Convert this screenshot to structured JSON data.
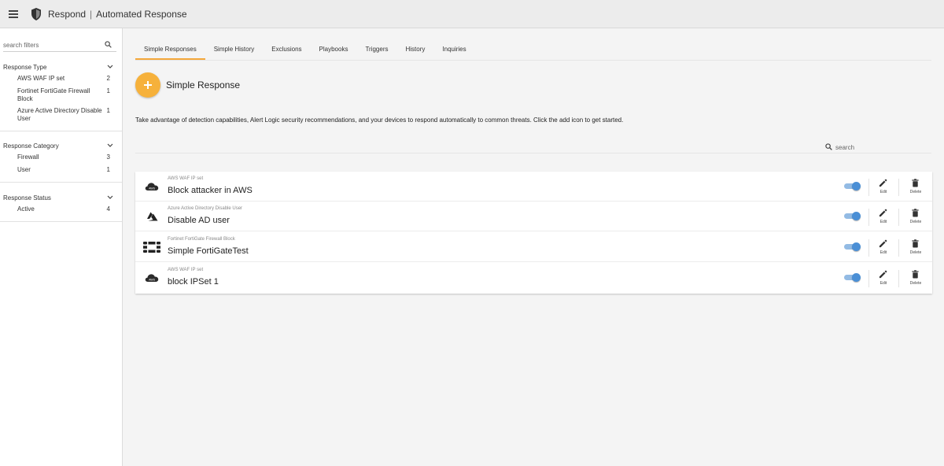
{
  "app": {
    "product": "Respond",
    "page": "Automated Response"
  },
  "sidebar": {
    "search_placeholder": "search filters",
    "facets": [
      {
        "title": "Response Type",
        "items": [
          {
            "label": "AWS WAF IP set",
            "count": "2"
          },
          {
            "label": "Fortinet FortiGate Firewall Block",
            "count": "1"
          },
          {
            "label": "Azure Active Directory Disable User",
            "count": "1"
          }
        ]
      },
      {
        "title": "Response Category",
        "items": [
          {
            "label": "Firewall",
            "count": "3"
          },
          {
            "label": "User",
            "count": "1"
          }
        ]
      },
      {
        "title": "Response Status",
        "items": [
          {
            "label": "Active",
            "count": "4"
          }
        ]
      }
    ]
  },
  "tabs": [
    "Simple Responses",
    "Simple History",
    "Exclusions",
    "Playbooks",
    "Triggers",
    "History",
    "Inquiries"
  ],
  "active_tab": "Simple Responses",
  "section_title": "Simple Response",
  "description": "Take advantage of detection capabilities, Alert Logic security recommendations, and your devices to respond automatically to common threats. Click the add icon to get started.",
  "search_placeholder": "search",
  "responses": [
    {
      "type": "AWS WAF IP set",
      "name": "Block attacker in AWS",
      "icon": "aws-cloud-icon",
      "enabled": true
    },
    {
      "type": "Azure Active Directory Disable User",
      "name": "Disable AD user",
      "icon": "azure-icon",
      "enabled": true
    },
    {
      "type": "Fortinet FortiGate Firewall Block",
      "name": "Simple FortiGateTest",
      "icon": "fortinet-icon",
      "enabled": true
    },
    {
      "type": "AWS WAF IP set",
      "name": "block IPSet 1",
      "icon": "aws-cloud-icon",
      "enabled": true
    }
  ],
  "actions": {
    "edit": "Edit",
    "delete": "Delete"
  },
  "colors": {
    "accent": "#f6b13b",
    "toggle": "#4a8fd6"
  }
}
